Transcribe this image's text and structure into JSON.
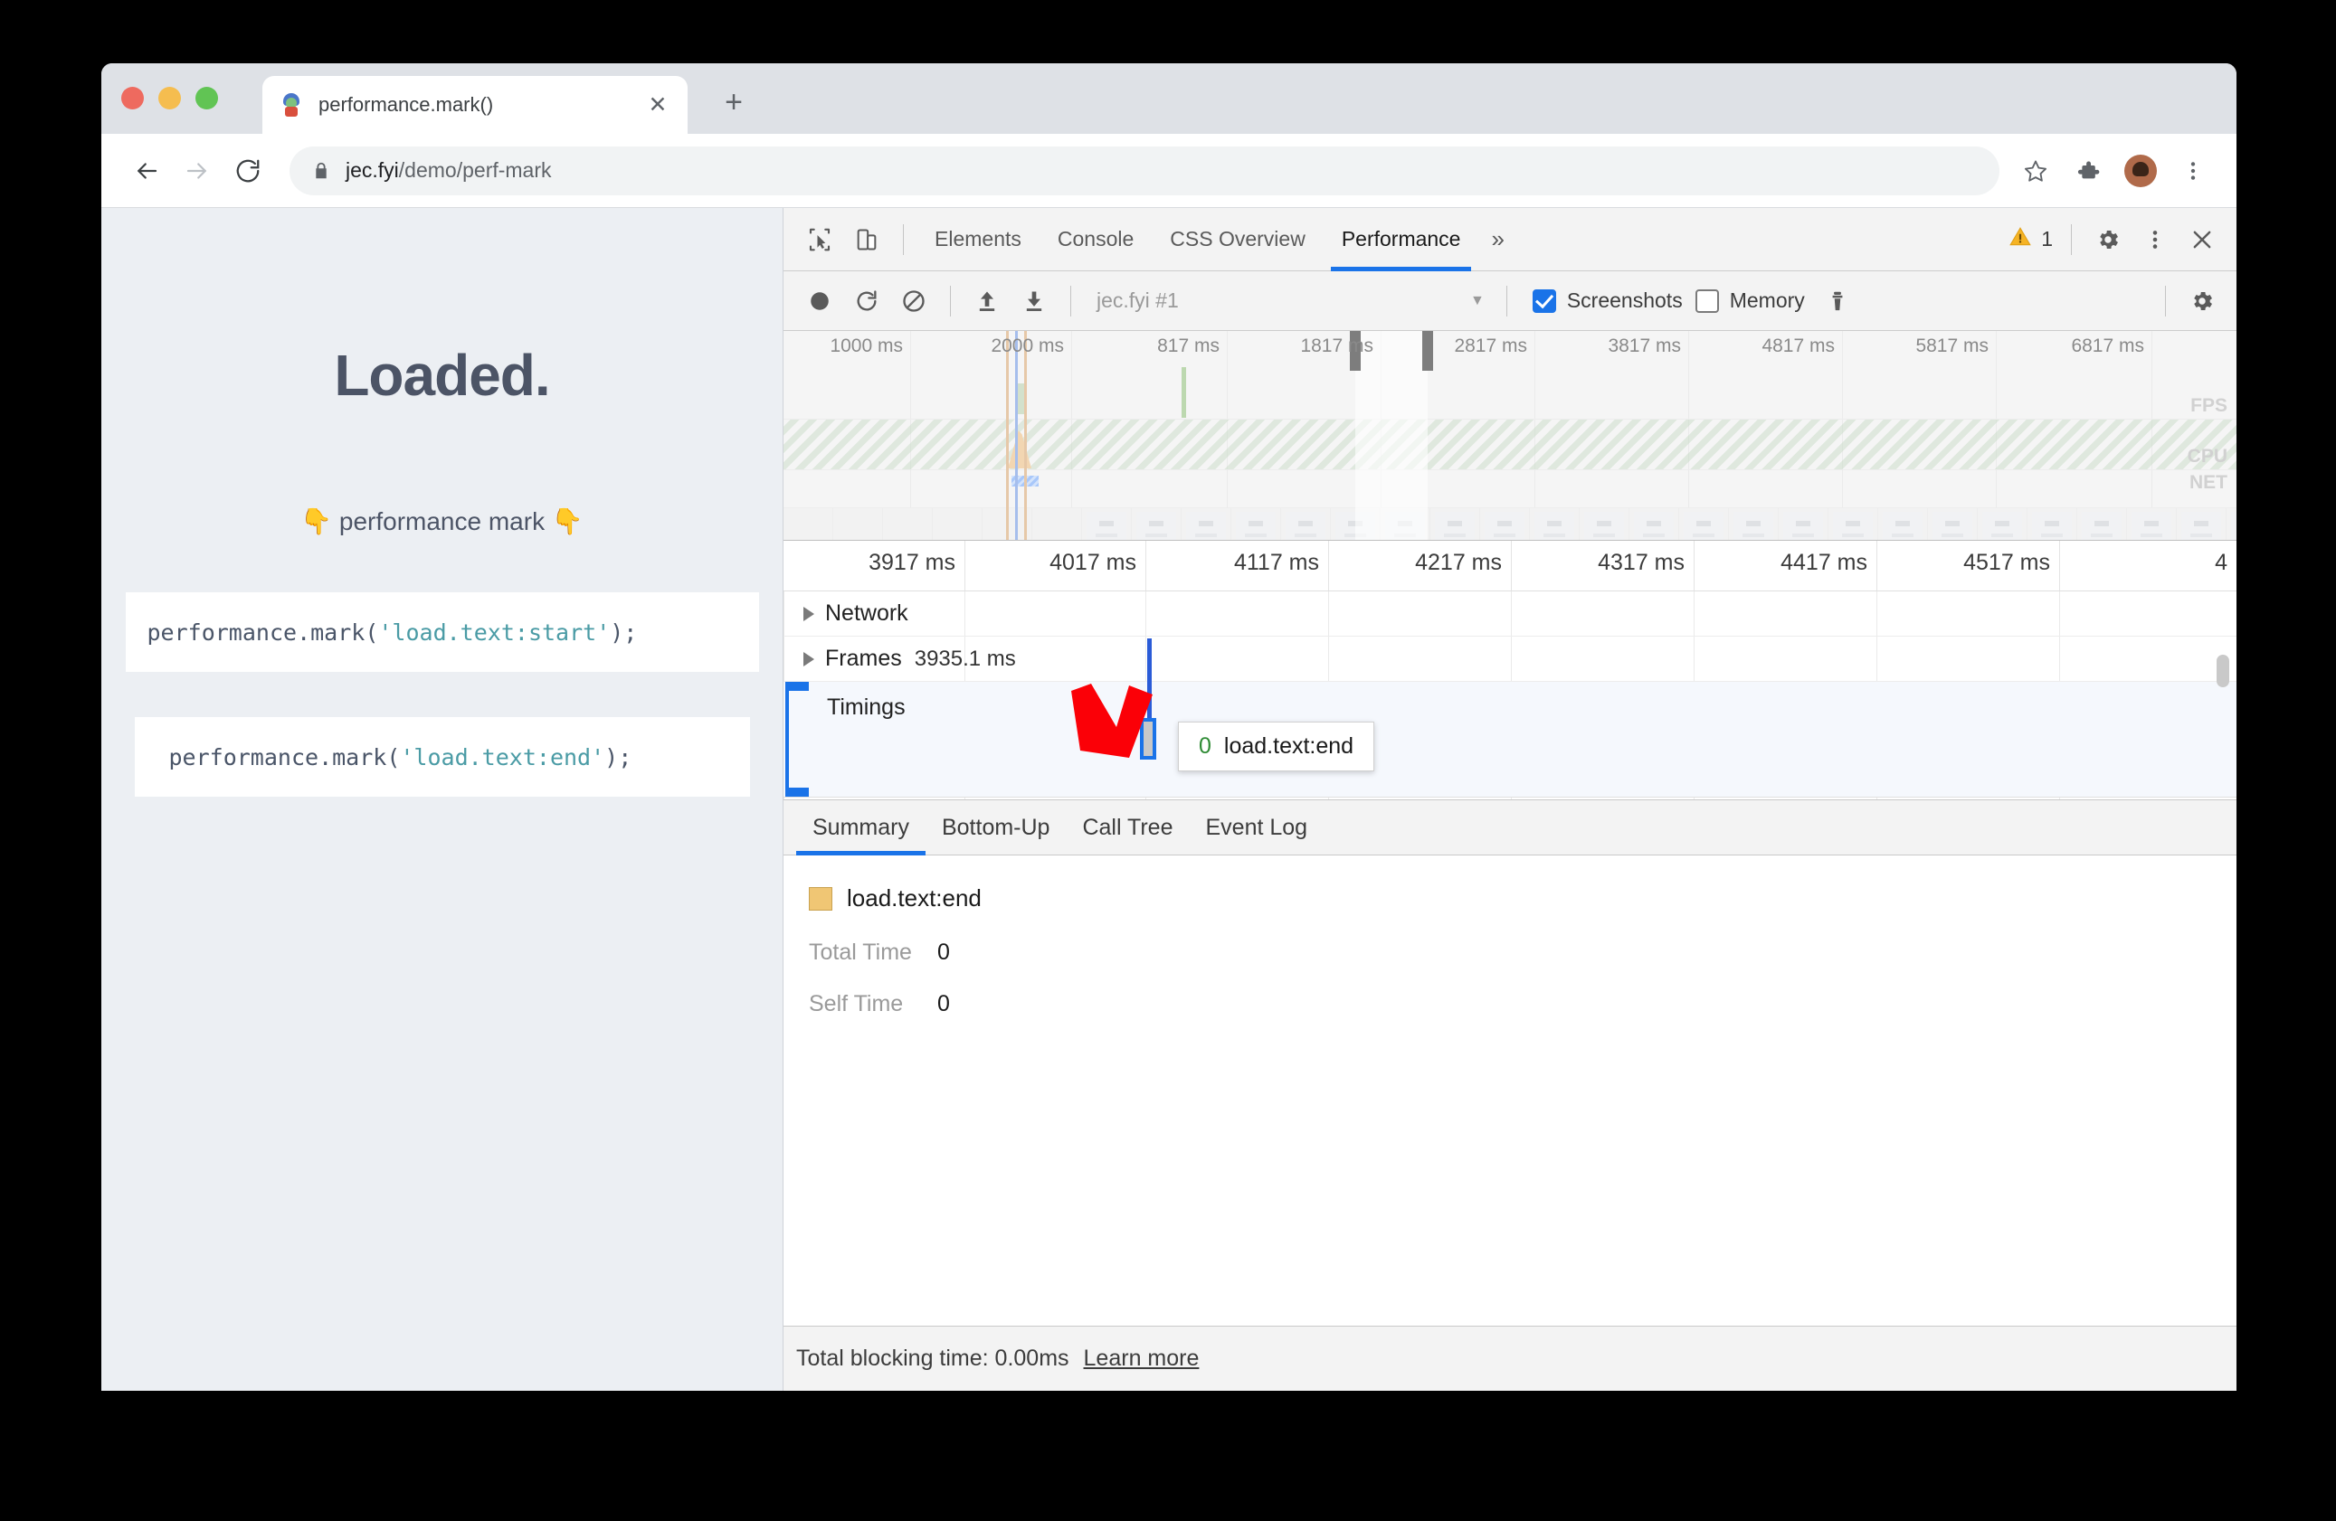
{
  "browser": {
    "tab": {
      "title": "performance.mark()",
      "favicon": "dino-favicon",
      "close_label": "✕"
    },
    "new_tab_label": "+",
    "url_host": "jec.fyi",
    "url_path": "/demo/perf-mark",
    "lock_icon": "lock-icon",
    "back_icon": "back-arrow-icon",
    "forward_icon": "forward-arrow-icon",
    "reload_icon": "reload-icon",
    "star_icon": "star-icon",
    "extensions_icon": "puzzle-piece-icon",
    "avatar_icon": "profile-avatar",
    "menu_icon": "three-dot-menu-icon"
  },
  "page": {
    "heading": "Loaded.",
    "subheading": "👇 performance mark 👇",
    "code_1": {
      "call": "performance.mark(",
      "string": "'load.text:start'",
      "end": ");"
    },
    "code_2": {
      "call": "performance.mark(",
      "string": "'load.text:end'",
      "end": ");"
    }
  },
  "devtools": {
    "tabs": [
      {
        "label": "Elements",
        "active": false
      },
      {
        "label": "Console",
        "active": false
      },
      {
        "label": "CSS Overview",
        "active": false
      },
      {
        "label": "Performance",
        "active": true
      }
    ],
    "more_tabs_label": "»",
    "inspect_icon": "inspect-cursor-icon",
    "device_toggle_icon": "device-toolbar-icon",
    "warning_count": "1",
    "warning_icon": "warning-triangle-icon",
    "settings_icon": "gear-icon",
    "kebab_icon": "three-dot-menu-icon",
    "close_icon": "close-x-icon",
    "toolbar": {
      "record_icon": "record-circle-icon",
      "reload_record_icon": "reload-and-record-icon",
      "clear_icon": "clear-prohibited-icon",
      "upload_icon": "load-profile-upload-icon",
      "download_icon": "save-profile-download-icon",
      "session_name": "jec.fyi #1",
      "session_caret_icon": "chevron-down-icon",
      "screenshots_label": "Screenshots",
      "screenshots_checked": true,
      "memory_label": "Memory",
      "memory_checked": false,
      "trash_icon": "collect-garbage-trash-icon",
      "capture_settings_icon": "gear-icon"
    },
    "overview": {
      "ruler_ticks": [
        "1000 ms",
        "2000 ms",
        "817 ms",
        "1817 ms",
        "2817 ms",
        "3817 ms",
        "4817 ms",
        "5817 ms",
        "6817 ms"
      ],
      "band_fps": "FPS",
      "band_cpu": "CPU",
      "band_net": "NET"
    },
    "detail_ruler_ticks": [
      "3917 ms",
      "4017 ms",
      "4117 ms",
      "4217 ms",
      "4317 ms",
      "4417 ms",
      "4517 ms",
      "4"
    ],
    "tracks": {
      "network_label": "Network",
      "frames_label": "Frames",
      "frames_value": "3935.1 ms",
      "timings_label": "Timings"
    },
    "tooltip": {
      "value": "0",
      "name": "load.text:end"
    },
    "detail_tabs": [
      {
        "label": "Summary",
        "active": true
      },
      {
        "label": "Bottom-Up",
        "active": false
      },
      {
        "label": "Call Tree",
        "active": false
      },
      {
        "label": "Event Log",
        "active": false
      }
    ],
    "summary": {
      "event_name": "load.text:end",
      "swatch_color": "#f0c674",
      "total_time_key": "Total Time",
      "total_time_value": "0",
      "self_time_key": "Self Time",
      "self_time_value": "0"
    },
    "status": {
      "text": "Total blocking time: 0.00ms",
      "link": "Learn more"
    }
  },
  "annotation": {
    "arrow_color": "#fb0007",
    "arrow_name": "red-pointer-arrow"
  }
}
